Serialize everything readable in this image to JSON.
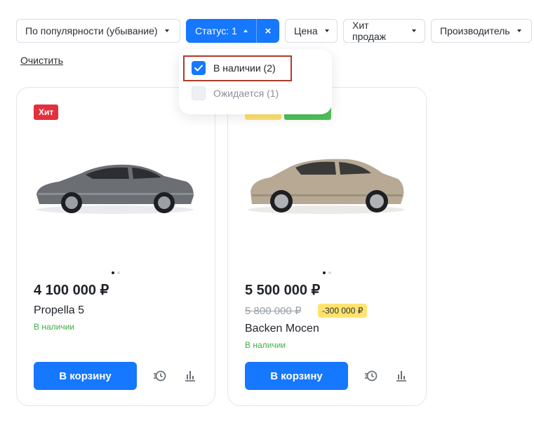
{
  "filters": {
    "sort_label": "По популярности (убывание)",
    "status_label": "Статус: 1",
    "clear_symbol": "×",
    "price_label": "Цена",
    "hit_label": "Хит продаж",
    "maker_label": "Производитель"
  },
  "clear_link": "Очистить",
  "dropdown": {
    "options": [
      {
        "label": "В наличии (2)",
        "checked": true
      },
      {
        "label": "Ожидается (1)",
        "checked": false
      }
    ]
  },
  "products": [
    {
      "badge": "Хит",
      "price": "4 100 000 ₽",
      "name": "Propella 5",
      "stock": "В наличии",
      "cart_label": "В корзину",
      "car_color": "#6b6f74"
    },
    {
      "price": "5 500 000 ₽",
      "old_price": "5 800 000 ₽",
      "discount": "-300 000 ₽",
      "name": "Backen Mocen",
      "stock": "В наличии",
      "cart_label": "В корзину",
      "car_color": "#b7a994"
    }
  ],
  "colors": {
    "accent": "#1677ff",
    "hit_badge": "#e2313c",
    "stock_green": "#3fae44",
    "discount_yellow": "#ffe36e"
  },
  "icons": [
    "check-icon",
    "compare-history-icon",
    "bar-chart-icon",
    "caret-down-icon",
    "caret-up-icon",
    "close-icon"
  ]
}
